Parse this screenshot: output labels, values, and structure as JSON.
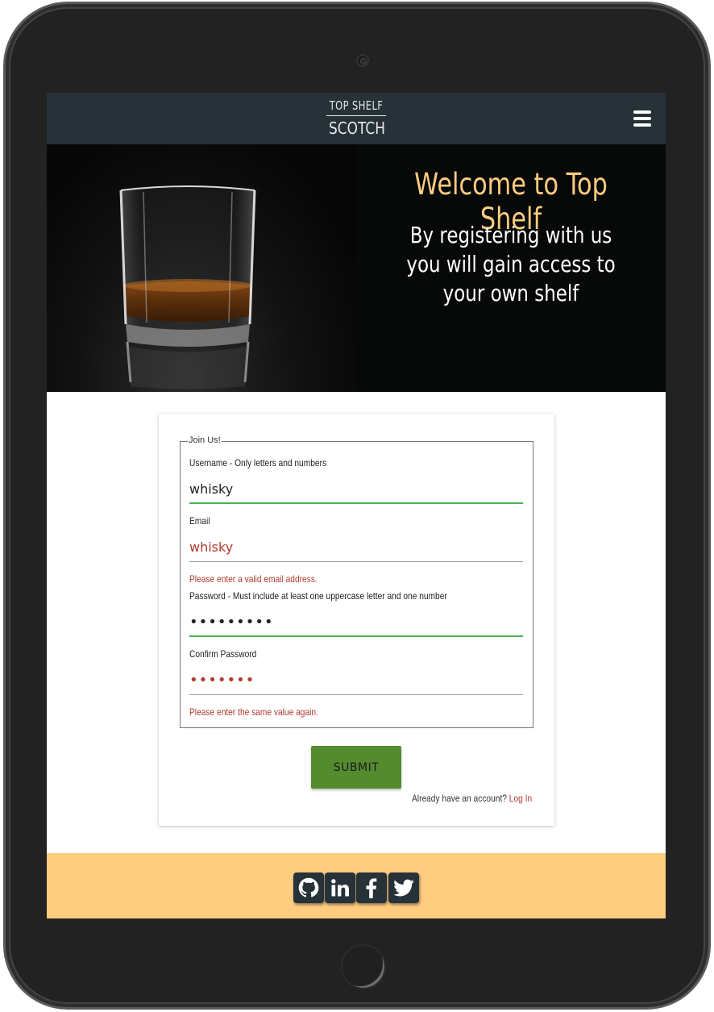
{
  "navbar": {
    "logo_top": "TOP SHELF",
    "logo_bottom": "SCOTCH",
    "menu_icon": "hamburger-icon"
  },
  "hero": {
    "title": "Welcome to Top Shelf",
    "subtitle": "By registering with us you will gain access to your own shelf"
  },
  "form": {
    "legend": "Join Us!",
    "username": {
      "label": "Username - Only letters and numbers",
      "value": "whisky"
    },
    "email": {
      "label": "Email",
      "value": "whisky",
      "error": "Please enter a valid email address."
    },
    "password": {
      "label": "Password - Must include at least one uppercase letter and one number",
      "value": "•••••••••"
    },
    "confirm_password": {
      "label": "Confirm Password",
      "value": "•••••••",
      "error": "Please enter the same value again."
    },
    "submit_label": "Submit",
    "already_text": "Already have an account?",
    "login_label": "Log In"
  },
  "footer": {
    "icons": [
      "github-icon",
      "linkedin-icon",
      "facebook-icon",
      "twitter-icon"
    ]
  },
  "colors": {
    "navbar": "#263238",
    "accent": "#ffcc80",
    "submit": "#558b2f",
    "valid": "#4caf50",
    "error": "#b03a2e"
  }
}
